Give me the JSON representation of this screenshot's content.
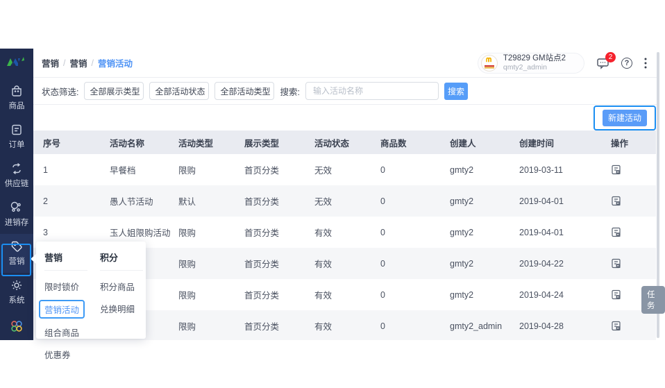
{
  "colors": {
    "sidebar_bg": "#202c4e",
    "annotation_blue": "#1b8ef2",
    "primary_button_blue": "#569df8",
    "link_blue": "#5094f5",
    "table_header_bg": "#e9ebf1",
    "zebra_row_bg": "#f5f6f8",
    "task_badge_bg": "#8995a5",
    "badge_red": "#f5222d"
  },
  "sidebar": {
    "items": [
      {
        "label": "商品",
        "icon": "bag-icon"
      },
      {
        "label": "订单",
        "icon": "order-icon"
      },
      {
        "label": "供应链",
        "icon": "supply-chain-icon"
      },
      {
        "label": "进销存",
        "icon": "inventory-icon"
      },
      {
        "label": "营销",
        "icon": "tag-icon",
        "active": true
      },
      {
        "label": "系统",
        "icon": "gear-icon"
      }
    ]
  },
  "topbar": {
    "breadcrumb": {
      "items": [
        "营销",
        "营销",
        "营销活动"
      ],
      "separator": "/"
    },
    "user": {
      "title": "T29829 GM站点2",
      "subtitle": "qmty2_admin"
    },
    "message_badge": "2",
    "help_glyph": "?"
  },
  "filters": {
    "status_label": "状态筛选:",
    "dropdowns": [
      "全部展示类型",
      "全部活动状态",
      "全部活动类型"
    ],
    "search_label": "搜索:",
    "search_placeholder": "输入活动名称",
    "search_button": "搜索"
  },
  "toolbar": {
    "new_button": "新建活动"
  },
  "table": {
    "headers": [
      "序号",
      "活动名称",
      "活动类型",
      "展示类型",
      "活动状态",
      "商品数",
      "创建人",
      "创建时间",
      "操作"
    ],
    "rows": [
      {
        "cells": [
          "1",
          "早餐档",
          "限购",
          "首页分类",
          "无效",
          "0",
          "gmty2",
          "2019-03-11"
        ]
      },
      {
        "cells": [
          "2",
          "愚人节活动",
          "默认",
          "首页分类",
          "无效",
          "0",
          "gmty2",
          "2019-04-01"
        ]
      },
      {
        "cells": [
          "3",
          "玉人姐限购活动",
          "限购",
          "首页分类",
          "有效",
          "0",
          "gmty2",
          "2019-04-01"
        ]
      },
      {
        "cells": [
          "",
          "",
          "限购",
          "首页分类",
          "有效",
          "0",
          "gmty2",
          "2019-04-22"
        ]
      },
      {
        "cells": [
          "",
          "",
          "限购",
          "首页分类",
          "有效",
          "0",
          "gmty2",
          "2019-04-24"
        ]
      },
      {
        "cells": [
          "",
          "",
          "限购",
          "首页分类",
          "有效",
          "0",
          "gmty2_admin",
          "2019-04-28"
        ]
      }
    ]
  },
  "popup": {
    "columns": [
      {
        "title": "营销",
        "items": [
          "限时锁价",
          "营销活动",
          "组合商品",
          "优惠券"
        ],
        "active_item": "营销活动"
      },
      {
        "title": "积分",
        "items": [
          "积分商品",
          "兑换明细"
        ]
      }
    ]
  },
  "task_badge": "任务"
}
